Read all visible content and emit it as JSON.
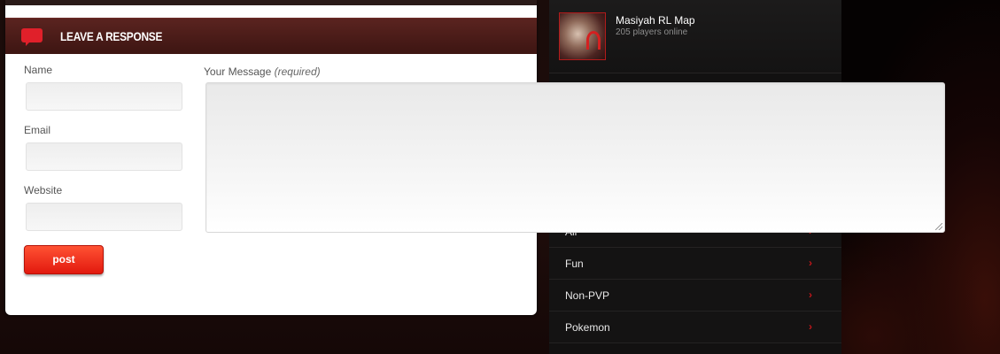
{
  "comments": {
    "header_title": "LEAVE A RESPONSE",
    "name_label": "Name",
    "email_label": "Email",
    "website_label": "Website",
    "message_label": "Your Message",
    "message_required": "(required)",
    "name_value": "",
    "email_value": "",
    "website_value": "",
    "message_value": "",
    "post_label": "post"
  },
  "sidebar": {
    "server": {
      "name": "Masiyah RL Map",
      "players": "205 players online"
    },
    "menu": [
      {
        "label": "All"
      },
      {
        "label": "Fun"
      },
      {
        "label": "Non-PVP"
      },
      {
        "label": "Pokemon"
      }
    ],
    "arrow_glyph": "›"
  },
  "colors": {
    "accent": "#e2190e",
    "header_bg": "#4a1b17",
    "sidebar_bg": "#121111"
  }
}
